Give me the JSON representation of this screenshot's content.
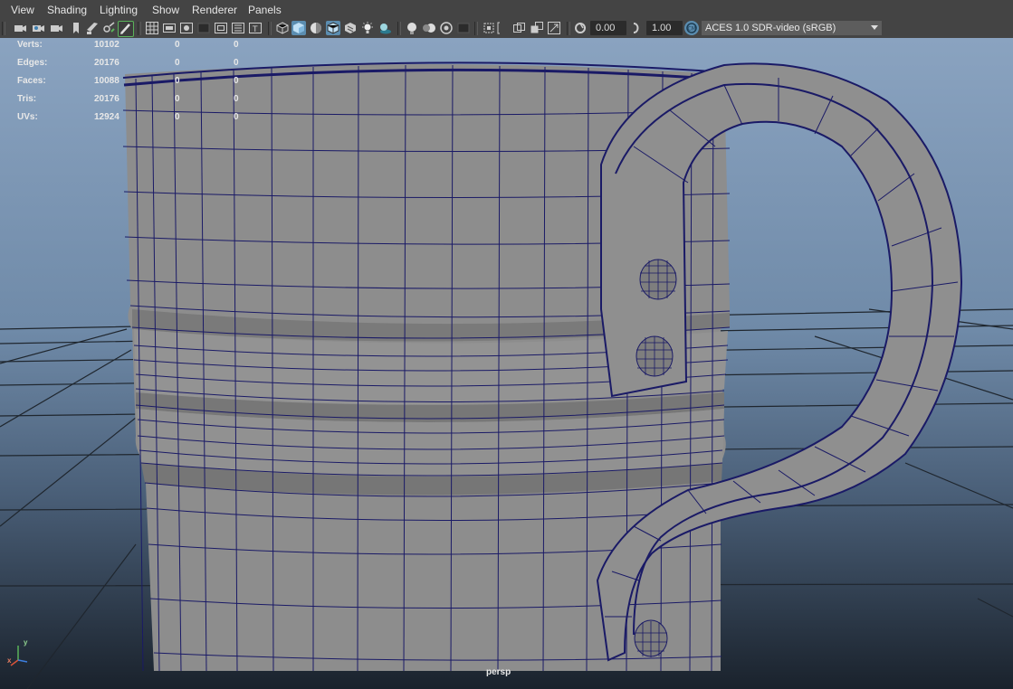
{
  "menu": [
    "View",
    "Shading",
    "Lighting",
    "Show",
    "Renderer",
    "Panels"
  ],
  "toolbar": {
    "exposure_value": "0.00",
    "gamma_value": "1.00",
    "color_space": "ACES 1.0 SDR-video (sRGB)",
    "icons": [
      "select-camera-icon",
      "camera-attributes-icon",
      "bookmark-icon",
      "image-plane-icon",
      "two-d-pan-zoom-icon",
      "grease-pencil-icon",
      "grid-icon",
      "film-gate-icon",
      "resolution-gate-icon",
      "gate-mask-icon",
      "field-chart-icon",
      "safe-action-icon",
      "safe-title-icon",
      "wireframe-icon",
      "smooth-shade-icon",
      "default-material-icon",
      "wireframe-on-shaded-icon",
      "textured-icon",
      "use-all-lights-icon",
      "shadows-icon",
      "screen-space-ao-icon",
      "motion-blur-icon",
      "multisample-aa-icon",
      "depth-of-field-icon",
      "isolate-select-icon",
      "xray-icon",
      "xray-joints-icon",
      "xray-components-icon",
      "exposure-icon",
      "gamma-icon",
      "color-management-icon"
    ]
  },
  "hud": {
    "rows": [
      {
        "label": "Verts:",
        "v1": "10102",
        "v2": "0",
        "v3": "0"
      },
      {
        "label": "Edges:",
        "v1": "20176",
        "v2": "0",
        "v3": "0"
      },
      {
        "label": "Faces:",
        "v1": "10088",
        "v2": "0",
        "v3": "0"
      },
      {
        "label": "Tris:",
        "v1": "20176",
        "v2": "0",
        "v3": "0"
      },
      {
        "label": "UVs:",
        "v1": "12924",
        "v2": "0",
        "v3": "0"
      }
    ]
  },
  "camera_label": "persp",
  "axis": {
    "x": "x",
    "y": "y"
  },
  "colors": {
    "wire": "#1a1a66",
    "mesh": "#8c8c8c",
    "grid": "#2a2f36",
    "accent": "#5b8db0"
  }
}
